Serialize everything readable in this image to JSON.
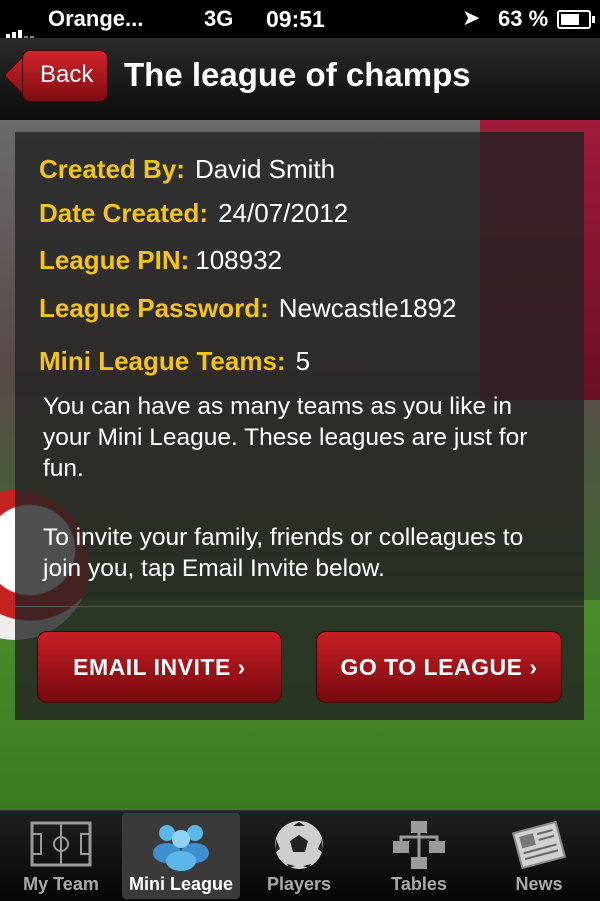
{
  "status_bar": {
    "carrier": "Orange...",
    "network": "3G",
    "time": "09:51",
    "battery": "63 %"
  },
  "nav": {
    "back_label": "Back",
    "title": "The league of champs"
  },
  "league": {
    "created_by_label": "Created By:",
    "created_by": "David Smith",
    "date_created_label": "Date Created:",
    "date_created": "24/07/2012",
    "pin_label": "League PIN:",
    "pin": "108932",
    "password_label": "League Password:",
    "password": "Newcastle1892",
    "teams_label": "Mini League Teams:",
    "teams": "5",
    "description_1": "You can have as many teams as you like in your Mini League. These leagues are just for fun.",
    "description_2": "To invite your family, friends or colleagues to join you, tap Email Invite below."
  },
  "actions": {
    "email_invite": "EMAIL INVITE ›",
    "go_to_league": "GO TO LEAGUE ›"
  },
  "tabs": [
    {
      "label": "My Team",
      "icon": "pitch-icon"
    },
    {
      "label": "Mini League",
      "icon": "group-icon",
      "active": true
    },
    {
      "label": "Players",
      "icon": "football-icon"
    },
    {
      "label": "Tables",
      "icon": "hierarchy-icon"
    },
    {
      "label": "News",
      "icon": "newspaper-icon"
    }
  ],
  "colors": {
    "accent_label": "#f4c418",
    "button_red": "#c81e24"
  }
}
